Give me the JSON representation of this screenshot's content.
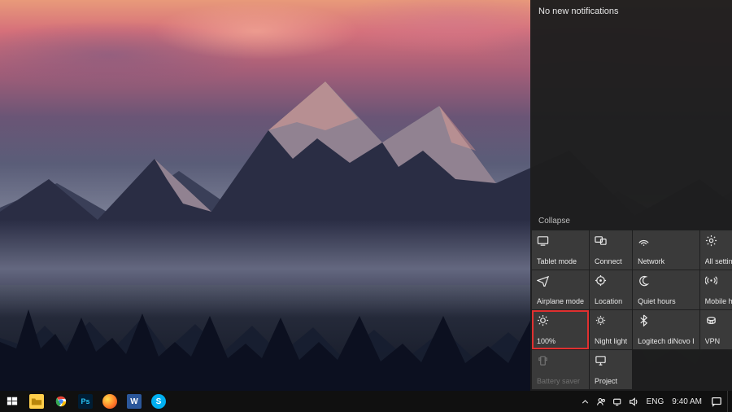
{
  "action_center": {
    "header": "No new notifications",
    "collapse": "Collapse",
    "tiles": [
      {
        "icon": "tablet-icon",
        "label": "Tablet mode"
      },
      {
        "icon": "connect-icon",
        "label": "Connect"
      },
      {
        "icon": "network-icon",
        "label": "Network"
      },
      {
        "icon": "settings-icon",
        "label": "All settings"
      },
      {
        "icon": "airplane-icon",
        "label": "Airplane mode"
      },
      {
        "icon": "location-icon",
        "label": "Location"
      },
      {
        "icon": "quiet-icon",
        "label": "Quiet hours"
      },
      {
        "icon": "hotspot-icon",
        "label": "Mobile hotspot"
      },
      {
        "icon": "brightness-icon",
        "label": "100%",
        "highlight": true
      },
      {
        "icon": "nightlight-icon",
        "label": "Night light"
      },
      {
        "icon": "bluetooth-icon",
        "label": "Logitech diNovo I"
      },
      {
        "icon": "vpn-icon",
        "label": "VPN"
      },
      {
        "icon": "battery-icon",
        "label": "Battery saver",
        "disabled": true
      },
      {
        "icon": "project-icon",
        "label": "Project"
      }
    ]
  },
  "taskbar": {
    "apps": [
      {
        "name": "start",
        "color": "#ffffff"
      },
      {
        "name": "file-explorer",
        "color": "#ffcf4b"
      },
      {
        "name": "chrome",
        "color": "#ffffff"
      },
      {
        "name": "photoshop",
        "color": "#001d34",
        "letter": "Ps",
        "fg": "#29c5f6"
      },
      {
        "name": "firefox",
        "color": "#ff7e29"
      },
      {
        "name": "word",
        "color": "#2b579a",
        "letter": "W"
      },
      {
        "name": "skype",
        "color": "#00aff0",
        "letter": "S"
      }
    ],
    "tray": {
      "lang": "ENG",
      "time": "9:40 AM"
    }
  }
}
